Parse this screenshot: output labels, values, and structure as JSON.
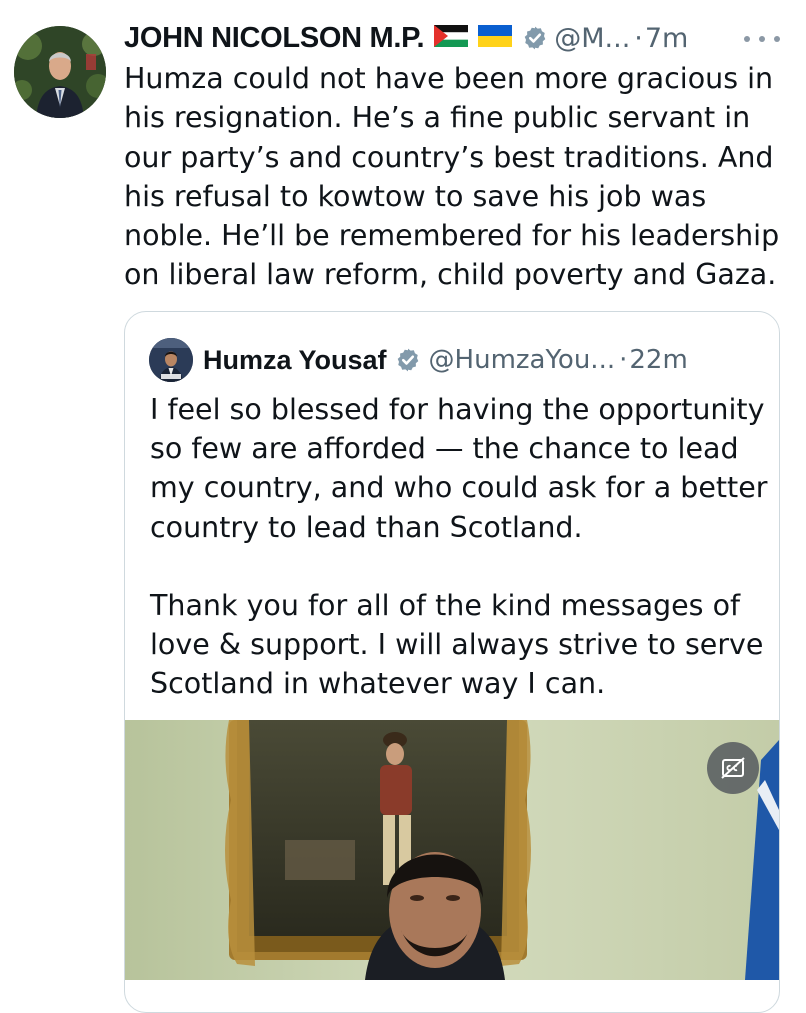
{
  "tweet": {
    "author_name": "JOHN NICOLSON M.P.",
    "flags": [
      "palestine-flag",
      "ukraine-flag"
    ],
    "handle": "@M...",
    "separator": "·",
    "time": "7m",
    "text": "Humza could not have been more gracious in his resignation. He’s a fine public servant in our party’s and country’s best traditions. And his refusal to kowtow to save his job was noble. He’ll be remembered for his leadership on liberal law reform, child poverty and Gaza.",
    "more_icon": "more-horizontal-icon"
  },
  "quote": {
    "author_name": "Humza Yousaf",
    "handle": "@HumzaYou...",
    "separator": "·",
    "time": "22m",
    "paragraph_1": "I feel so blessed for having the opportunity so few are afforded — the chance to lead my country, and who could ask for a better country to lead than Scotland.",
    "paragraph_2": "Thank you for all of the kind messages of love & support. I will always strive to serve Scotland in whatever way I can.",
    "media": {
      "type": "video",
      "cc_icon": "closed-captions-off-icon"
    }
  },
  "colors": {
    "text_primary": "#0f1419",
    "text_secondary": "#536471",
    "verified_badge": "#829aab",
    "border": "#cfd9de"
  }
}
